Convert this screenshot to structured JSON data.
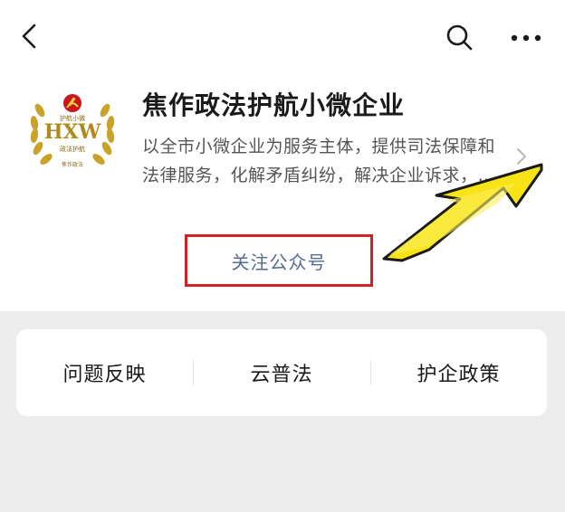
{
  "account": {
    "name": "焦作政法护航小微企业",
    "description": "以全市小微企业为服务主体，提供司法保障和法律服务，化解矛盾纠纷，解决企业诉求，…",
    "logo": {
      "letters": "HXW",
      "top_text": "护航小微",
      "middle_text": "政法护航",
      "bottom_text": "焦作政法"
    }
  },
  "actions": {
    "follow_label": "关注公众号"
  },
  "menu": [
    {
      "label": "问题反映"
    },
    {
      "label": "云普法"
    },
    {
      "label": "护企政策"
    }
  ],
  "icons": {
    "back": "chevron-left-icon",
    "search": "search-icon",
    "more": "more-dots-icon",
    "detail": "chevron-right-icon",
    "annotation": "yellow-arrow-icon"
  },
  "colors": {
    "follow_text": "#576b95",
    "highlight_box": "#d31f26",
    "arrow_fill": "#f7e316",
    "logo_gold": "#c9a227",
    "logo_red": "#c8161d"
  }
}
